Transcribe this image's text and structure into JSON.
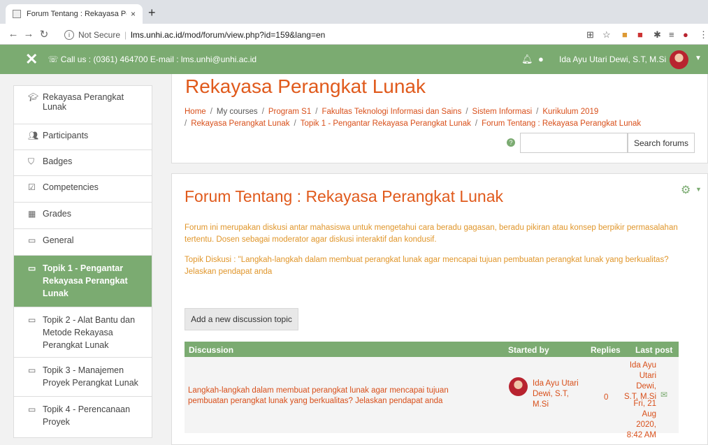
{
  "browser": {
    "tab_title": "Forum Tentang : Rekayasa Pera",
    "tab_close": "×",
    "new_tab": "+",
    "security_label": "Not Secure",
    "url_domain": "lms.unhi.ac.id",
    "url_path": "/mod/forum/view.php?id=159&lang=en"
  },
  "navbar": {
    "contact": "Call us : (0361) 464700  E-mail : lms.unhi@unhi.ac.id",
    "user_name": "Ida Ayu Utari Dewi, S.T, M.Si",
    "brand_color": "#7bab71"
  },
  "sidebar": {
    "items": [
      {
        "label": "Rekayasa Perangkat Lunak",
        "icon": "graduation-cap-icon"
      },
      {
        "label": "Participants",
        "icon": "users-icon"
      },
      {
        "label": "Badges",
        "icon": "shield-icon"
      },
      {
        "label": "Competencies",
        "icon": "checkbox-icon"
      },
      {
        "label": "Grades",
        "icon": "table-icon"
      },
      {
        "label": "General",
        "icon": "folder-icon"
      },
      {
        "label": "Topik 1 - Pengantar Rekayasa Perangkat Lunak",
        "icon": "folder-icon"
      },
      {
        "label": "Topik 2 - Alat Bantu dan Metode Rekayasa Perangkat Lunak",
        "icon": "folder-icon"
      },
      {
        "label": "Topik 3 - Manajemen Proyek Perangkat Lunak",
        "icon": "folder-icon"
      },
      {
        "label": "Topik 4 - Perencanaan Proyek",
        "icon": "folder-icon"
      }
    ]
  },
  "header": {
    "course_title": "Rekayasa Perangkat Lunak",
    "breadcrumb": [
      "Home",
      "My courses",
      "Program S1",
      "Fakultas Teknologi Informasi dan Sains",
      "Sistem Informasi",
      "Kurikulum 2019",
      "Rekayasa Perangkat Lunak",
      "Topik 1 - Pengantar Rekayasa Perangkat Lunak",
      "Forum Tentang : Rekayasa Perangkat Lunak"
    ],
    "search_button": "Search forums"
  },
  "main": {
    "forum_title": "Forum Tentang : Rekayasa Perangkat Lunak",
    "description": "Forum ini merupakan diskusi antar mahasiswa untuk mengetahui cara beradu gagasan, beradu pikiran atau konsep berpikir permasalahan tertentu. Dosen sebagai moderator agar diskusi interaktif dan kondusif.",
    "topic": "Topik Diskusi : \"Langkah-langkah dalam membuat perangkat lunak agar mencapai tujuan pembuatan perangkat lunak yang berkualitas? Jelaskan pendapat anda",
    "add_button": "Add a new discussion topic",
    "table": {
      "headers": [
        "Discussion",
        "Started by",
        "Replies",
        "Last post"
      ],
      "rows": [
        {
          "discussion": "Langkah-langkah dalam membuat perangkat lunak agar mencapai tujuan pembuatan perangkat lunak yang berkualitas? Jelaskan pendapat anda",
          "started_by": "Ida Ayu Utari Dewi, S.T, M.Si",
          "replies": "0",
          "last_post_user": "Ida Ayu Utari Dewi, S.T, M.Si",
          "last_post_date": "Fri, 21 Aug 2020, 8:42 AM"
        }
      ]
    }
  }
}
